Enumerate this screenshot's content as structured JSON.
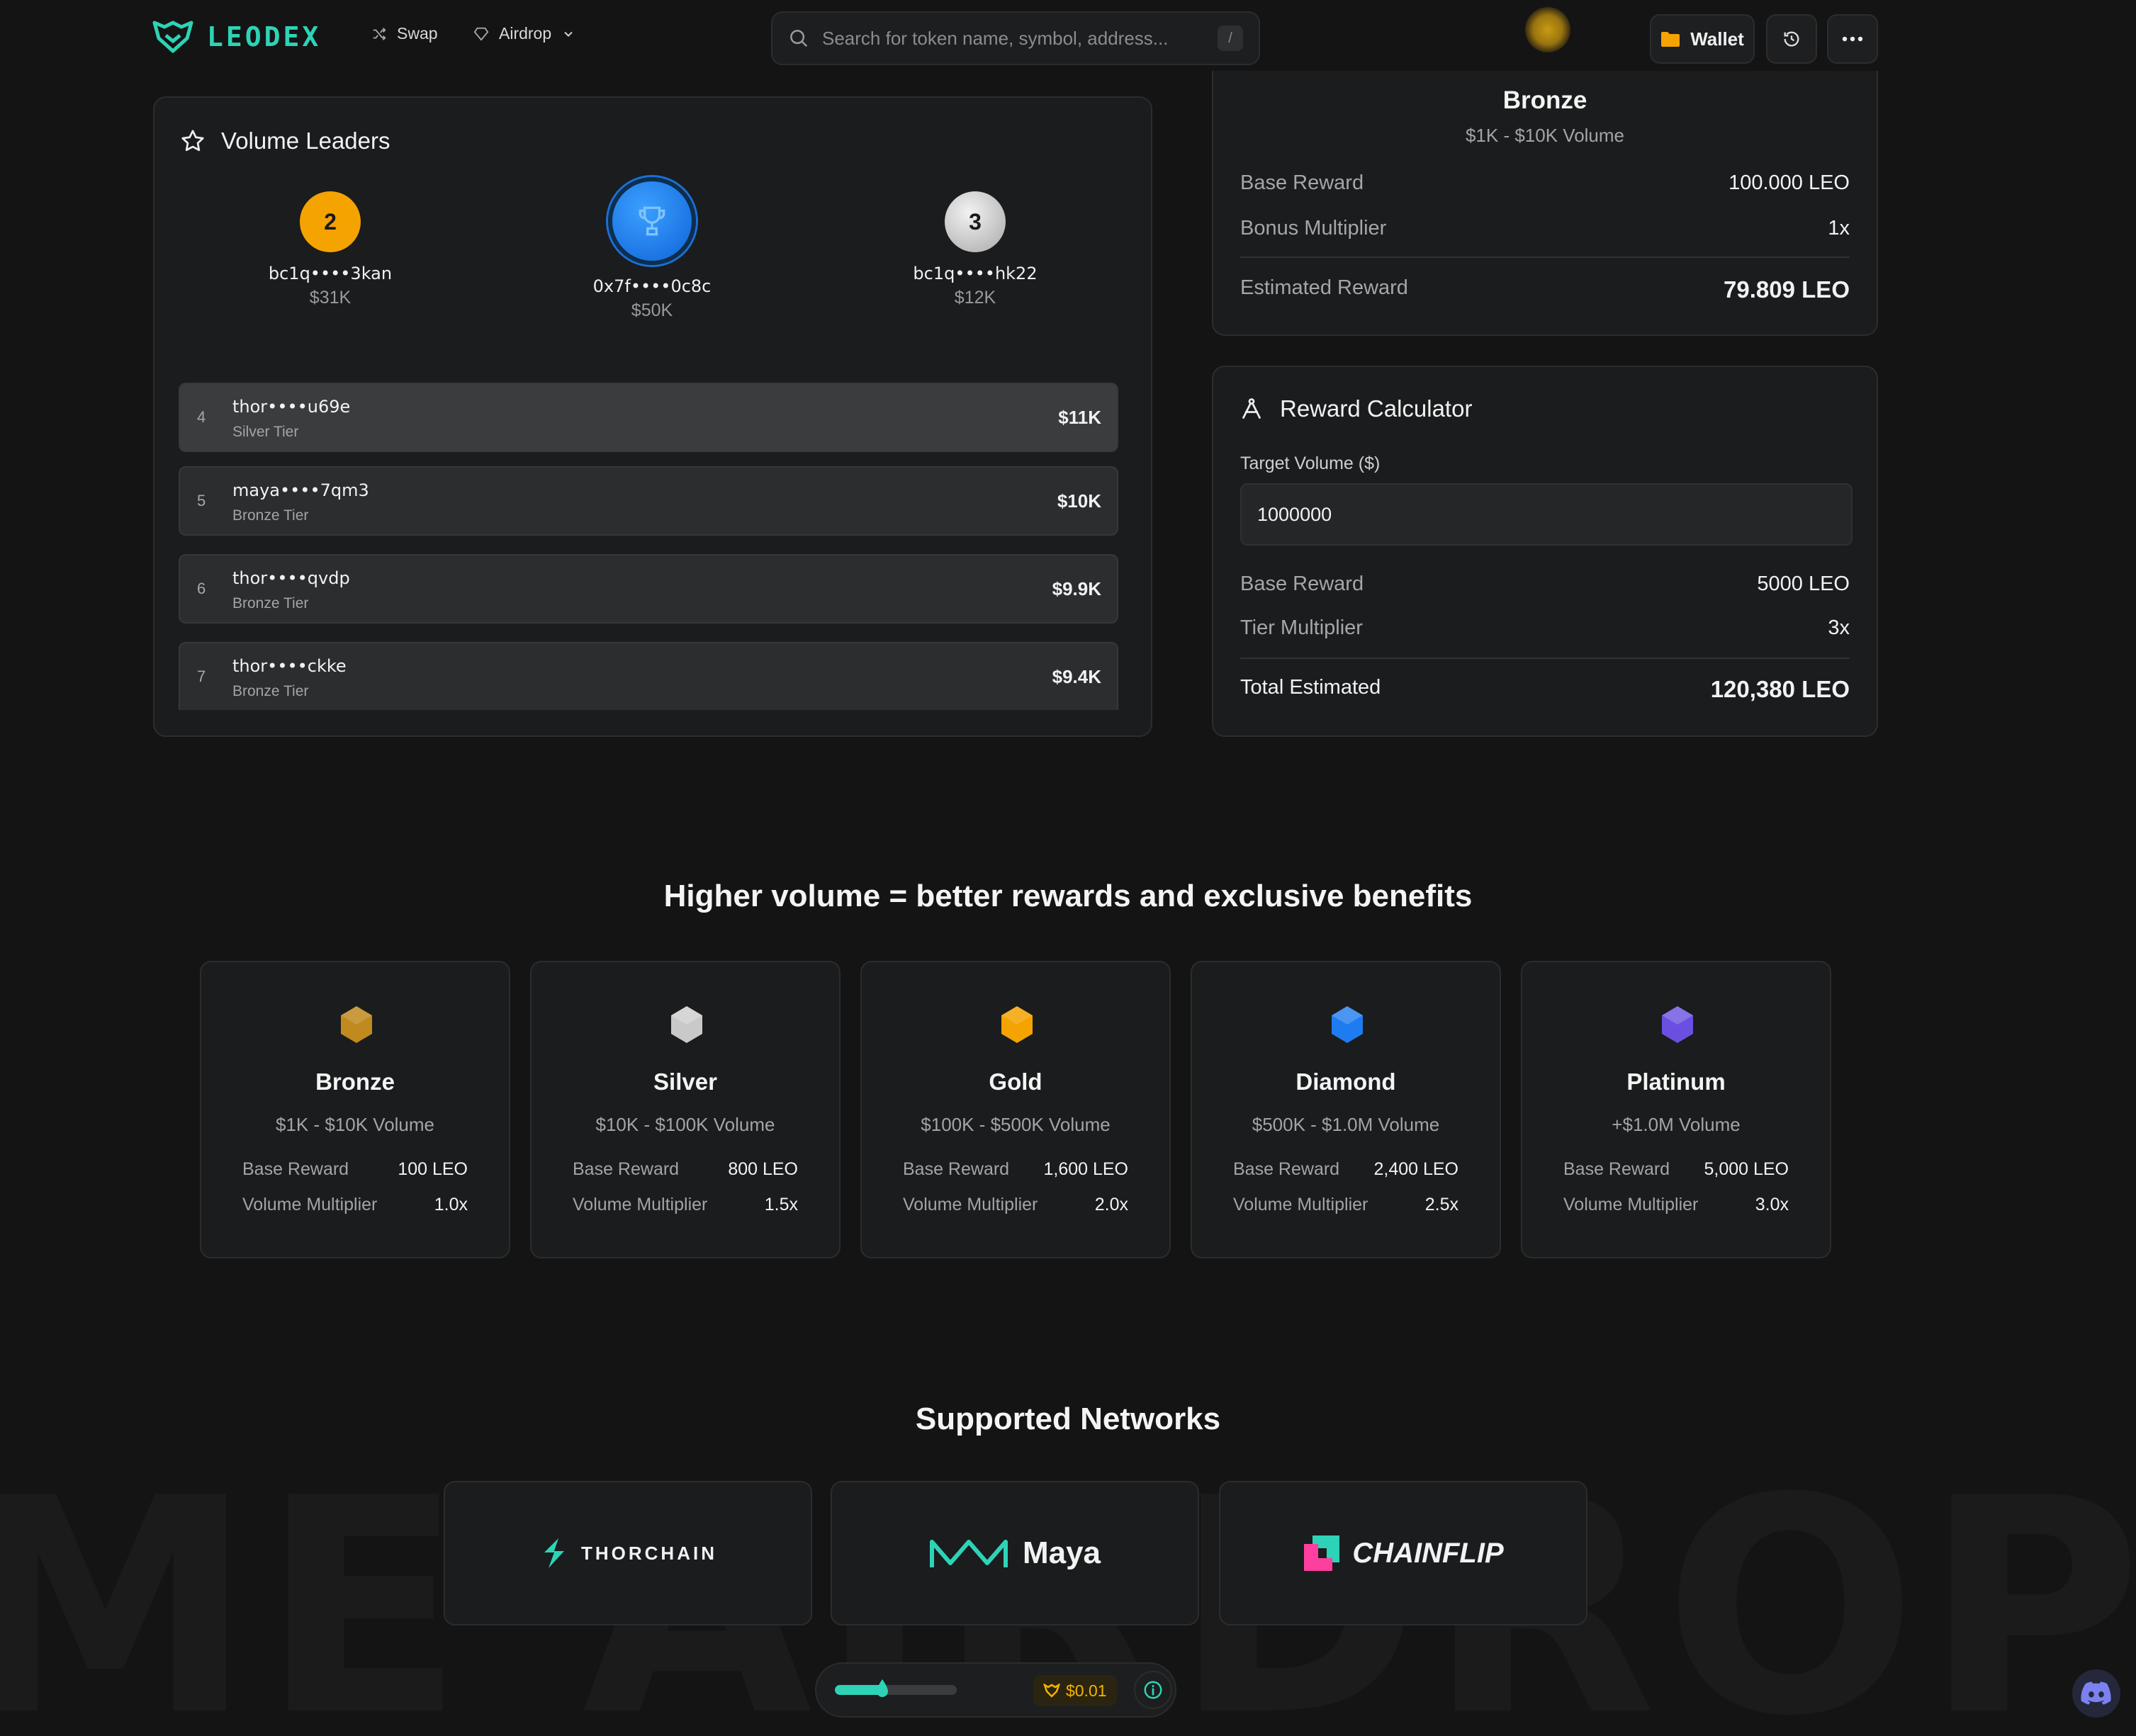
{
  "header": {
    "logo_text": "LEODEX",
    "nav": [
      {
        "label": "Swap",
        "icon": "shuffle-icon"
      },
      {
        "label": "Airdrop",
        "icon": "gem-icon"
      }
    ],
    "search_placeholder": "Search for token name, symbol, address...",
    "search_shortcut": "/",
    "wallet_label": "Wallet"
  },
  "volume_leaders": {
    "title": "Volume Leaders",
    "podium": [
      {
        "rank": "2",
        "address": "bc1q••••3kan",
        "volume": "$31K"
      },
      {
        "rank": "1",
        "address": "0x7f••••0c8c",
        "volume": "$50K"
      },
      {
        "rank": "3",
        "address": "bc1q••••hk22",
        "volume": "$12K"
      }
    ],
    "rows": [
      {
        "rank": "4",
        "address": "thor••••u69e",
        "tier": "Silver Tier",
        "volume": "$11K"
      },
      {
        "rank": "5",
        "address": "maya••••7qm3",
        "tier": "Bronze Tier",
        "volume": "$10K"
      },
      {
        "rank": "6",
        "address": "thor••••qvdp",
        "tier": "Bronze Tier",
        "volume": "$9.9K"
      },
      {
        "rank": "7",
        "address": "thor••••ckke",
        "tier": "Bronze Tier",
        "volume": "$9.4K"
      }
    ]
  },
  "current_tier": {
    "name": "Bronze",
    "range": "$1K - $10K Volume",
    "base_reward_label": "Base Reward",
    "base_reward": "100.000 LEO",
    "bonus_multiplier_label": "Bonus Multiplier",
    "bonus_multiplier": "1x",
    "estimated_reward_label": "Estimated Reward",
    "estimated_reward": "79.809 LEO"
  },
  "calculator": {
    "title": "Reward Calculator",
    "target_label": "Target Volume ($)",
    "target_value": "1000000",
    "base_reward_label": "Base Reward",
    "base_reward": "5000 LEO",
    "tier_multiplier_label": "Tier Multiplier",
    "tier_multiplier": "3x",
    "total_label": "Total Estimated",
    "total": "120,380 LEO"
  },
  "tiers_section": {
    "title": "Higher volume = better rewards and exclusive benefits",
    "base_reward_label": "Base Reward",
    "volume_multiplier_label": "Volume Multiplier",
    "tiers": [
      {
        "name": "Bronze",
        "range": "$1K - $10K Volume",
        "base_reward": "100 LEO",
        "multiplier": "1.0x",
        "color": "#c08a1e"
      },
      {
        "name": "Silver",
        "range": "$10K - $100K Volume",
        "base_reward": "800 LEO",
        "multiplier": "1.5x",
        "color": "#c9c9c9"
      },
      {
        "name": "Gold",
        "range": "$100K - $500K Volume",
        "base_reward": "1,600 LEO",
        "multiplier": "2.0x",
        "color": "#f5a300"
      },
      {
        "name": "Diamond",
        "range": "$500K - $1.0M Volume",
        "base_reward": "2,400 LEO",
        "multiplier": "2.5x",
        "color": "#1e7bf0"
      },
      {
        "name": "Platinum",
        "range": "+$1.0M Volume",
        "base_reward": "5,000 LEO",
        "multiplier": "3.0x",
        "color": "#6a4fe0"
      }
    ]
  },
  "networks": {
    "title": "Supported Networks",
    "items": [
      "THORCHAIN",
      "Maya",
      "CHAINFLIP"
    ]
  },
  "footer": {
    "price": "$0.01",
    "progress": 0.4
  },
  "watermark": "ME AIRDROP VO",
  "colors": {
    "accent": "#2ed3b7",
    "background": "#141414",
    "panel": "#1a1c1d"
  }
}
